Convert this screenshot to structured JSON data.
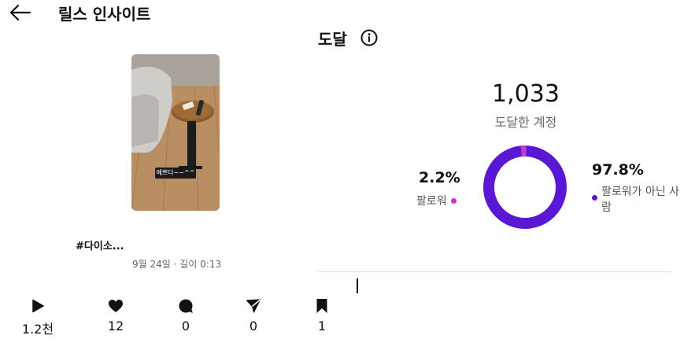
{
  "header": {
    "title": "릴스 인사이트",
    "back_icon": "arrow-left-icon"
  },
  "reel": {
    "caption_overlay": "예쁘다~~^^",
    "title": "#다이소...",
    "meta": "9월 24일 · 길이 0:13"
  },
  "stats": [
    {
      "icon": "play-icon",
      "value": "1.2천"
    },
    {
      "icon": "heart-icon",
      "value": "12"
    },
    {
      "icon": "comment-icon",
      "value": "0"
    },
    {
      "icon": "share-icon",
      "value": "0"
    },
    {
      "icon": "bookmark-icon",
      "value": "1"
    }
  ],
  "reach": {
    "title": "도달",
    "info_icon": "info-icon",
    "accounts_reached": "1,033",
    "accounts_reached_label": "도달한 계정",
    "followers_pct": "2.2%",
    "followers_label": "팔로워",
    "non_followers_pct": "97.8%",
    "non_followers_label": "팔로워가 아닌 사람",
    "followers_fraction": 0.022,
    "colors": {
      "followers": "#c13bc4",
      "non_followers": "#5b17d6"
    }
  }
}
